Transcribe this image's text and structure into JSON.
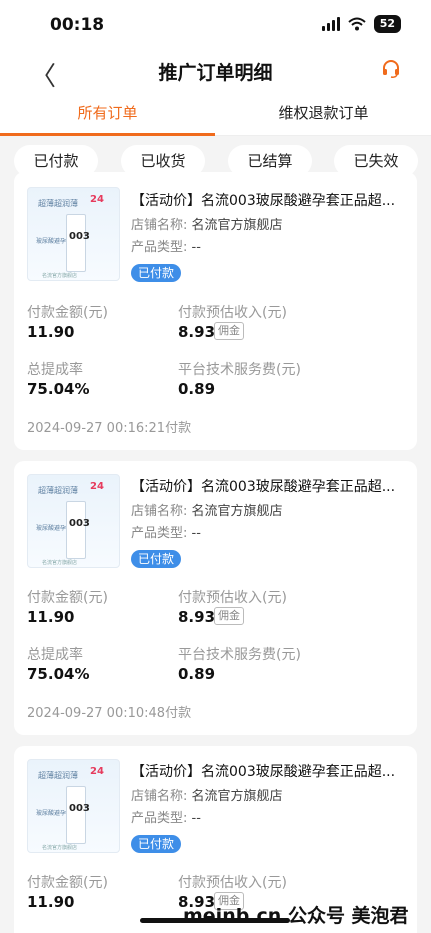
{
  "status": {
    "time": "00:18",
    "battery": "52"
  },
  "nav": {
    "back_glyph": "〈",
    "title": "推广订单明细",
    "service_icon": "headset-icon"
  },
  "tabs": [
    "所有订单",
    "维权退款订单"
  ],
  "filters": [
    "已付款",
    "已收货",
    "已结算",
    "已失效"
  ],
  "thumb": {
    "tagline": "超薄超润薄",
    "count": "24",
    "big": "003",
    "small": "玻尿酸避孕套",
    "bottom": "名流官方旗舰店"
  },
  "orders": [
    {
      "product": "【活动价】名流003玻尿酸避孕套正品超...",
      "shop_label": "店铺名称:",
      "shop": "名流官方旗舰店",
      "type_label": "产品类型:",
      "type": "--",
      "status": "已付款",
      "pay_label": "付款金额(元)",
      "pay": "11.90",
      "income_label": "付款预估收入(元)",
      "income": "8.93",
      "commission_tag": "佣金",
      "rate_label": "总提成率",
      "rate": "75.04%",
      "fee_label": "平台技术服务费(元)",
      "fee": "0.89",
      "time": "2024-09-27 00:16:21付款"
    },
    {
      "product": "【活动价】名流003玻尿酸避孕套正品超...",
      "shop_label": "店铺名称:",
      "shop": "名流官方旗舰店",
      "type_label": "产品类型:",
      "type": "--",
      "status": "已付款",
      "pay_label": "付款金额(元)",
      "pay": "11.90",
      "income_label": "付款预估收入(元)",
      "income": "8.93",
      "commission_tag": "佣金",
      "rate_label": "总提成率",
      "rate": "75.04%",
      "fee_label": "平台技术服务费(元)",
      "fee": "0.89",
      "time": "2024-09-27 00:10:48付款"
    },
    {
      "product": "【活动价】名流003玻尿酸避孕套正品超...",
      "shop_label": "店铺名称:",
      "shop": "名流官方旗舰店",
      "type_label": "产品类型:",
      "type": "--",
      "status": "已付款",
      "pay_label": "付款金额(元)",
      "pay": "11.90",
      "income_label": "付款预估收入(元)",
      "income": "8.93",
      "commission_tag": "佣金"
    }
  ],
  "watermark": "meinb.cn 公众号 美泡君",
  "colors": {
    "accent": "#f06b1c",
    "badge": "#3e8ee8",
    "background": "#f4f4f4"
  }
}
